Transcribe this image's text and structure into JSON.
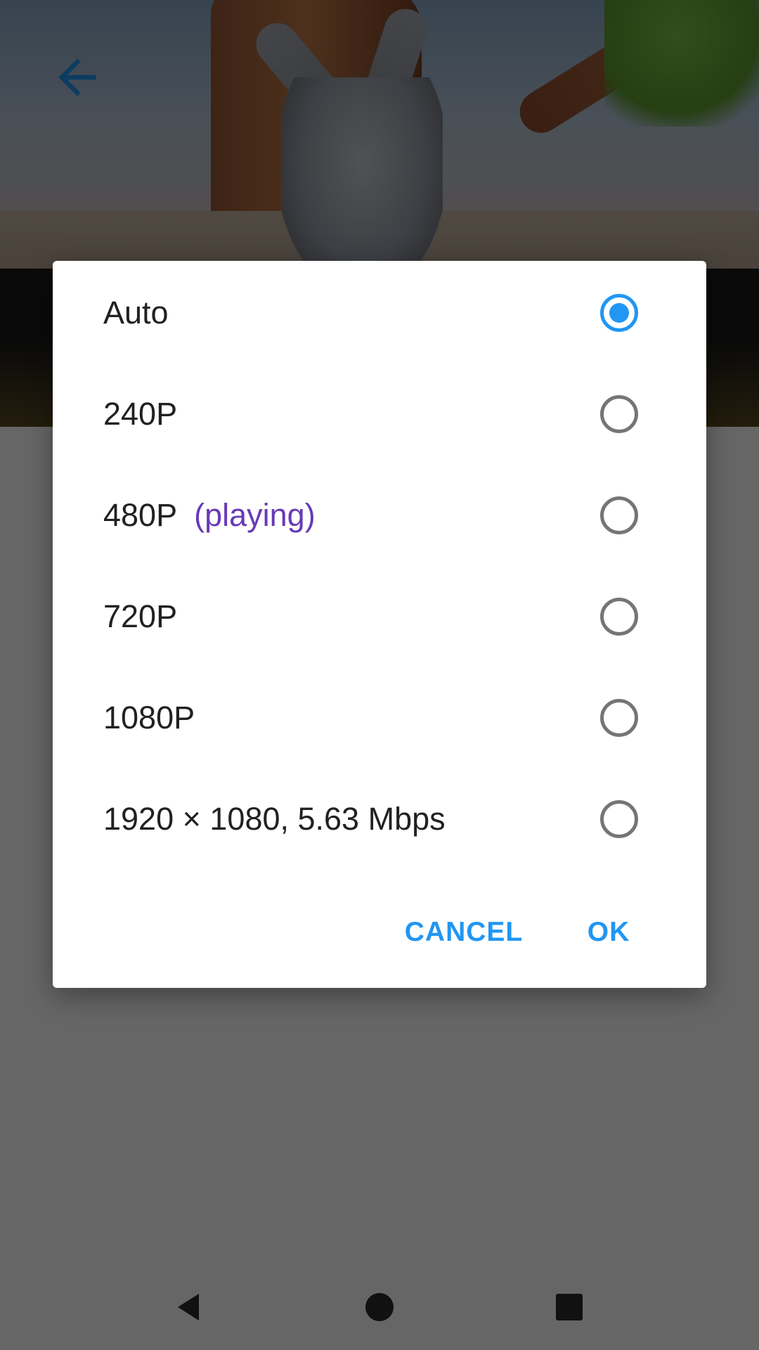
{
  "colors": {
    "accent": "#2196f3",
    "playing_tag": "#673ab7",
    "text_primary": "#212121",
    "radio_unchecked": "#757575",
    "scrim": "rgba(0,0,0,0.6)"
  },
  "toolbar": {
    "back_icon": "arrow-back-icon"
  },
  "dialog": {
    "options": [
      {
        "label": "Auto",
        "tag": "",
        "selected": true
      },
      {
        "label": "240P",
        "tag": "",
        "selected": false
      },
      {
        "label": "480P",
        "tag": "(playing)",
        "selected": false
      },
      {
        "label": "720P",
        "tag": "",
        "selected": false
      },
      {
        "label": "1080P",
        "tag": "",
        "selected": false
      },
      {
        "label": "1920 × 1080, 5.63 Mbps",
        "tag": "",
        "selected": false
      }
    ],
    "cancel_label": "CANCEL",
    "ok_label": "OK"
  },
  "nav": {
    "back_icon": "nav-back-icon",
    "home_icon": "nav-home-icon",
    "recents_icon": "nav-recents-icon"
  }
}
